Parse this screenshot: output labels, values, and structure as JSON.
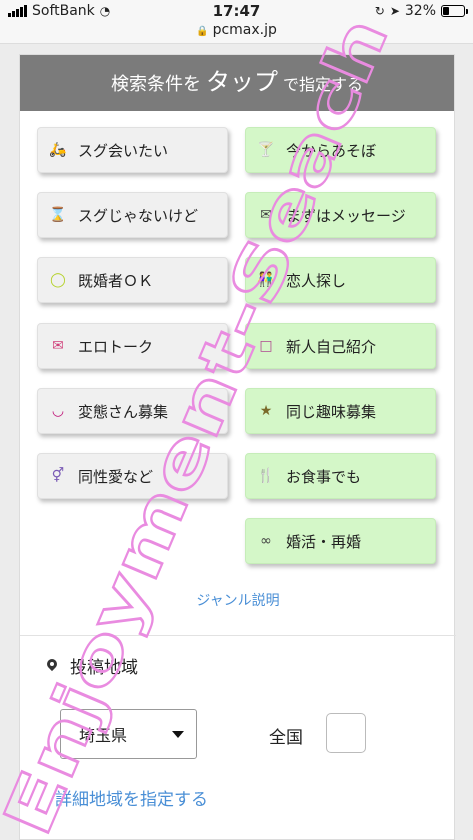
{
  "status_bar": {
    "carrier": "SoftBank",
    "time": "17:47",
    "battery_text": "32%",
    "battery_level": 0.32
  },
  "browser": {
    "url": "pcmax.jp"
  },
  "search": {
    "title_part1": "検索条件を",
    "title_part2": "タップ",
    "title_part3": "で指定する"
  },
  "genres_left": [
    {
      "label": "スグ会いたい",
      "icon": "scooter-icon"
    },
    {
      "label": "スグじゃないけど",
      "icon": "hourglass-icon"
    },
    {
      "label": "既婚者ＯＫ",
      "icon": "ring-icon"
    },
    {
      "label": "エロトーク",
      "icon": "heart-envelope-icon"
    },
    {
      "label": "変態さん募集",
      "icon": "mask-icon"
    },
    {
      "label": "同性愛など",
      "icon": "gender-icon"
    }
  ],
  "genres_right": [
    {
      "label": "今からあそぼ",
      "icon": "cocktail-icon"
    },
    {
      "label": "まずはメッセージ",
      "icon": "envelope-icon"
    },
    {
      "label": "恋人探し",
      "icon": "couple-icon"
    },
    {
      "label": "新人自己紹介",
      "icon": "profile-icon"
    },
    {
      "label": "同じ趣味募集",
      "icon": "hobby-icon"
    },
    {
      "label": "お食事でも",
      "icon": "fork-knife-icon"
    },
    {
      "label": "婚活・再婚",
      "icon": "rings-icon"
    }
  ],
  "genre_help_link": "ジャンル説明",
  "area": {
    "title": "投稿地域",
    "prefecture": "埼玉県",
    "nationwide_label": "全国",
    "nationwide_checked": false,
    "detail_link": "詳細地域を指定する"
  },
  "watermark_text": "Enjoyment-Seach",
  "colors": {
    "header": "#7b7b7b",
    "green_button": "#d4f7c8",
    "link": "#4a8fd6",
    "watermark": "#e98be0"
  }
}
